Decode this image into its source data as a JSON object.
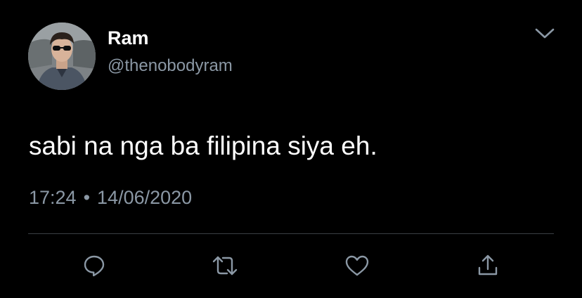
{
  "tweet": {
    "author": {
      "name": "Ram",
      "handle": "@thenobodyram",
      "avatar_icon": "profile-photo"
    },
    "text": "sabi na nga ba filipina siya eh.",
    "time": "17:24",
    "separator": "•",
    "date": "14/06/2020",
    "menu_icon": "chevron-down-icon"
  },
  "actions": [
    {
      "name": "reply",
      "icon": "reply-icon"
    },
    {
      "name": "retweet",
      "icon": "retweet-icon"
    },
    {
      "name": "like",
      "icon": "heart-icon"
    },
    {
      "name": "share",
      "icon": "share-icon"
    }
  ],
  "colors": {
    "background": "#000000",
    "primary_text": "#ffffff",
    "secondary_text": "#8b98a5",
    "divider": "#3a3f44",
    "icon": "#8b98a5"
  }
}
